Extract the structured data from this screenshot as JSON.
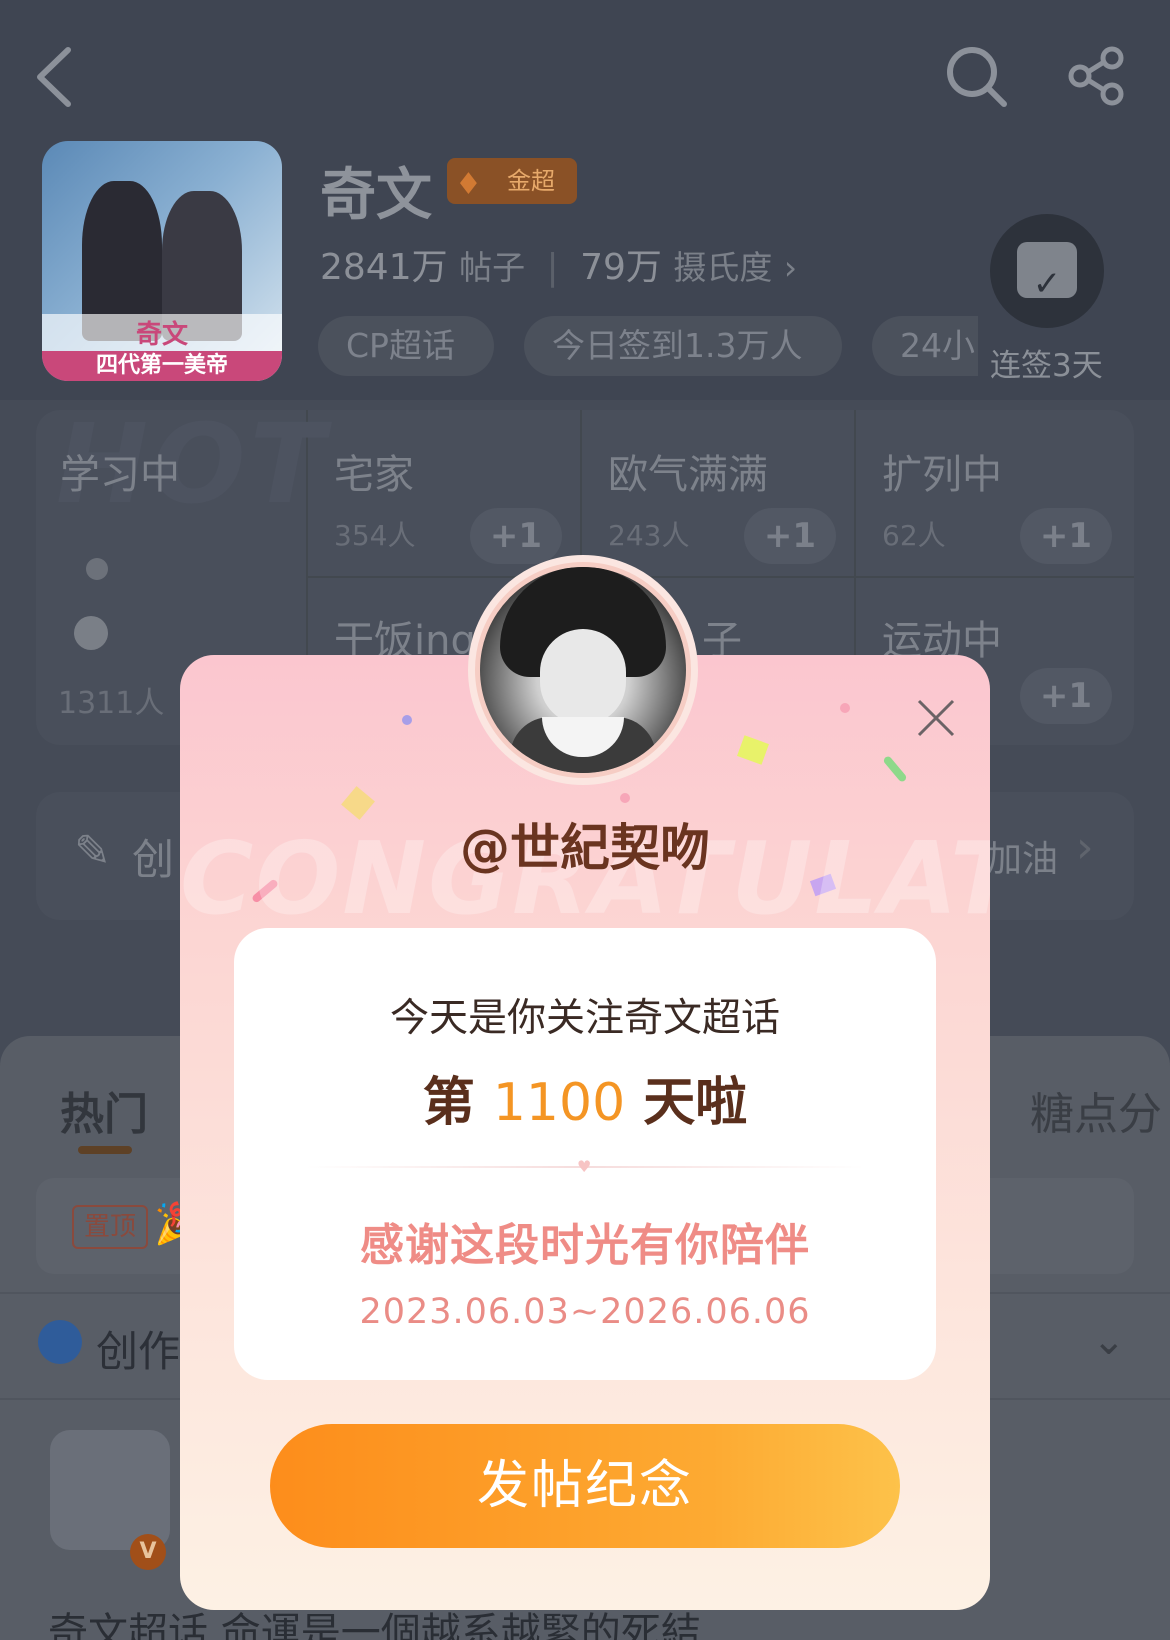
{
  "header": {
    "back_icon": "chevron-left-icon",
    "search_icon": "search-icon",
    "share_icon": "share-icon",
    "topic_name": "奇文",
    "badge_label": "金超",
    "posts_count": "2841万",
    "posts_label": "帖子",
    "fan_value": "79万",
    "fan_label": "摄氏度",
    "tags": [
      "CP超话",
      "今日签到1.3万人",
      "24小"
    ],
    "checkin_label": "连签3天",
    "cover_text": "奇文",
    "cover_subtext": "四代第一美帝"
  },
  "mood_grid": {
    "main_label": "学习中",
    "main_count": "1311人",
    "watermark": "HOT",
    "cells": [
      {
        "name": "宅家",
        "count": "354人",
        "plus": "+1"
      },
      {
        "name": "欧气满满",
        "count": "243人",
        "plus": "+1"
      },
      {
        "name": "扩列中",
        "count": "62人",
        "plus": "+1"
      },
      {
        "name": "干饭ing",
        "count": "",
        "plus": ""
      },
      {
        "name": "子",
        "count": "",
        "plus": ""
      },
      {
        "name": "运动中",
        "count": "",
        "plus": "+1"
      }
    ]
  },
  "bar2": {
    "left_label": "创",
    "right_label": "加油"
  },
  "feed": {
    "tabs": [
      "热门",
      "糖点分"
    ],
    "pin_label": "置顶",
    "creator_label": "创作",
    "bottom_text": "奇文超话  命運是一個越系越緊的死結"
  },
  "modal": {
    "username": "@世紀契吻",
    "watermark": "CONGRATULATE",
    "line1": "今天是你关注奇文超话",
    "line2_prefix": "第",
    "line2_number": "1100",
    "line2_suffix": "天啦",
    "line3": "感谢这段时光有你陪伴",
    "date_range": "2023.06.03~2026.06.06",
    "button_label": "发帖纪念",
    "close_icon": "close-icon"
  },
  "colors": {
    "accent_orange": "#f49524",
    "button_start": "#fd8d1b",
    "button_end": "#fdc24a",
    "thanks_pink": "#ef8c86",
    "username_brown": "#6a3420"
  }
}
